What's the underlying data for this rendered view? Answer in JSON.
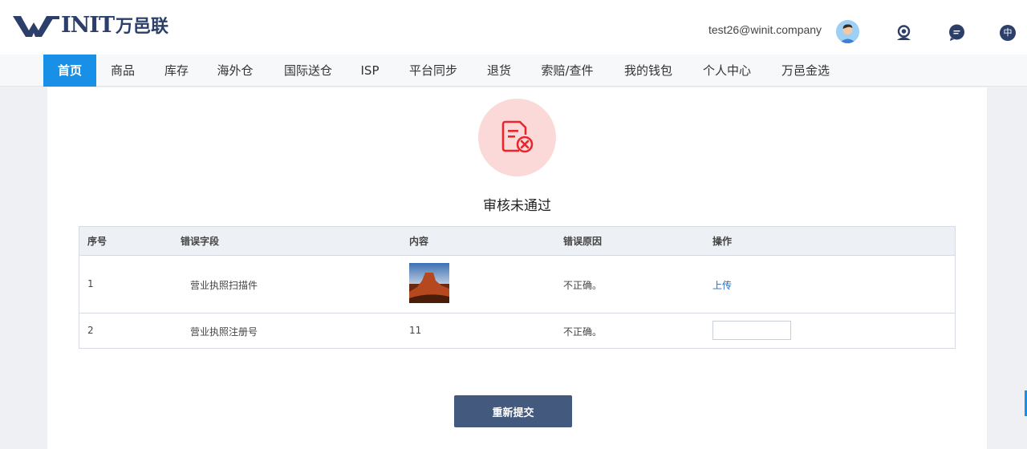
{
  "header": {
    "logo_text": "INIT",
    "logo_cn": "万邑联",
    "user_email": "test26@winit.company",
    "lang_label": "中",
    "icons": [
      "avatar",
      "customer-service-icon",
      "message-icon",
      "language-icon"
    ]
  },
  "nav": {
    "items": [
      {
        "label": "首页",
        "active": true
      },
      {
        "label": "商品"
      },
      {
        "label": "库存"
      },
      {
        "label": "海外仓"
      },
      {
        "label": "国际送仓"
      },
      {
        "label": "ISP"
      },
      {
        "label": "平台同步"
      },
      {
        "label": "退货"
      },
      {
        "label": "索赔/查件"
      },
      {
        "label": "我的钱包"
      },
      {
        "label": "个人中心"
      },
      {
        "label": "万邑金选"
      }
    ]
  },
  "status": {
    "text": "审核未通过",
    "icon": "document-reject-icon",
    "color": "#e8262b",
    "bg_color": "#fcd9d9"
  },
  "table": {
    "headers": [
      "序号",
      "错误字段",
      "内容",
      "错误原因",
      "操作"
    ],
    "rows": [
      {
        "index": "1",
        "field": "营业执照扫描件",
        "content_type": "image",
        "reason": "不正确。",
        "action": "上传"
      },
      {
        "index": "2",
        "field": "营业执照注册号",
        "content": "11",
        "reason": "不正确。",
        "input_value": ""
      }
    ]
  },
  "resubmit_label": "重新提交",
  "colors": {
    "accent": "#1890e8",
    "brand": "#2b3f6a",
    "button": "#44597e",
    "link": "#2e6bb5"
  }
}
